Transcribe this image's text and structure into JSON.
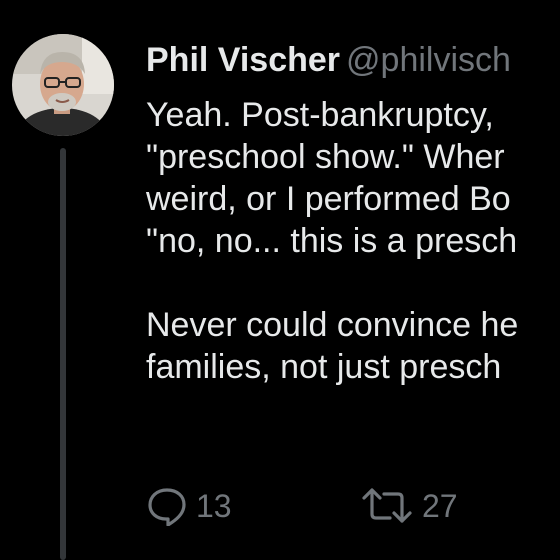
{
  "tweet": {
    "author": {
      "display_name": "Phil Vischer",
      "handle": "@philvisch"
    },
    "lines": [
      "Yeah.  Post-bankruptcy,",
      "\"preschool show.\"  Wher",
      "weird, or I performed Bo",
      "\"no, no... this is a presch",
      "",
      "Never could convince he",
      "families, not just presch"
    ],
    "actions": {
      "reply": {
        "icon": "reply-icon",
        "count": "13"
      },
      "retweet": {
        "icon": "retweet-icon",
        "count": "27"
      }
    }
  },
  "colors": {
    "background": "#000000",
    "text_primary": "#e7e9ea",
    "text_secondary": "#71767b",
    "thread_line": "#333639"
  }
}
